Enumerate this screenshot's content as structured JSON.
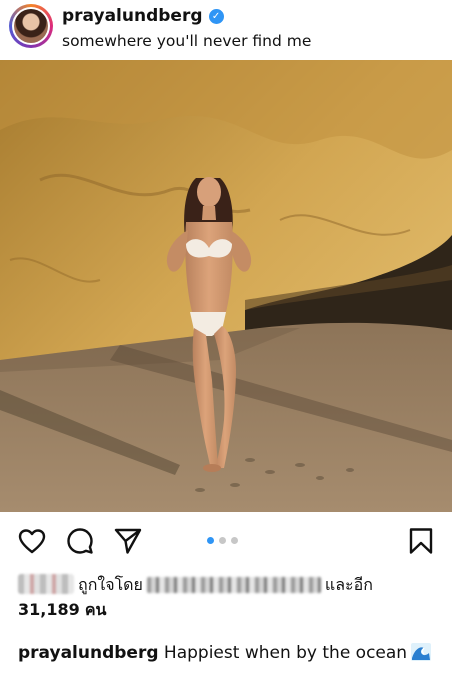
{
  "post": {
    "username": "prayalundberg",
    "location": "somewhere you'll never find me",
    "verified_icon": "verified-badge-icon",
    "carousel": {
      "count": 3,
      "active_index": 0
    }
  },
  "likes": {
    "prefix": "ถูกใจโดย",
    "connector": "และอีก",
    "count": "31,189",
    "unit": "คน"
  },
  "caption": {
    "username": "prayalundberg",
    "text": "Happiest when by the ocean",
    "emoji": "wave-emoji"
  },
  "icons": {
    "like": "heart-icon",
    "comment": "comment-icon",
    "share": "send-icon",
    "save": "bookmark-icon"
  },
  "colors": {
    "accent": "#2f95f5",
    "rock": "#c99a45",
    "sand": "#9c8466"
  }
}
